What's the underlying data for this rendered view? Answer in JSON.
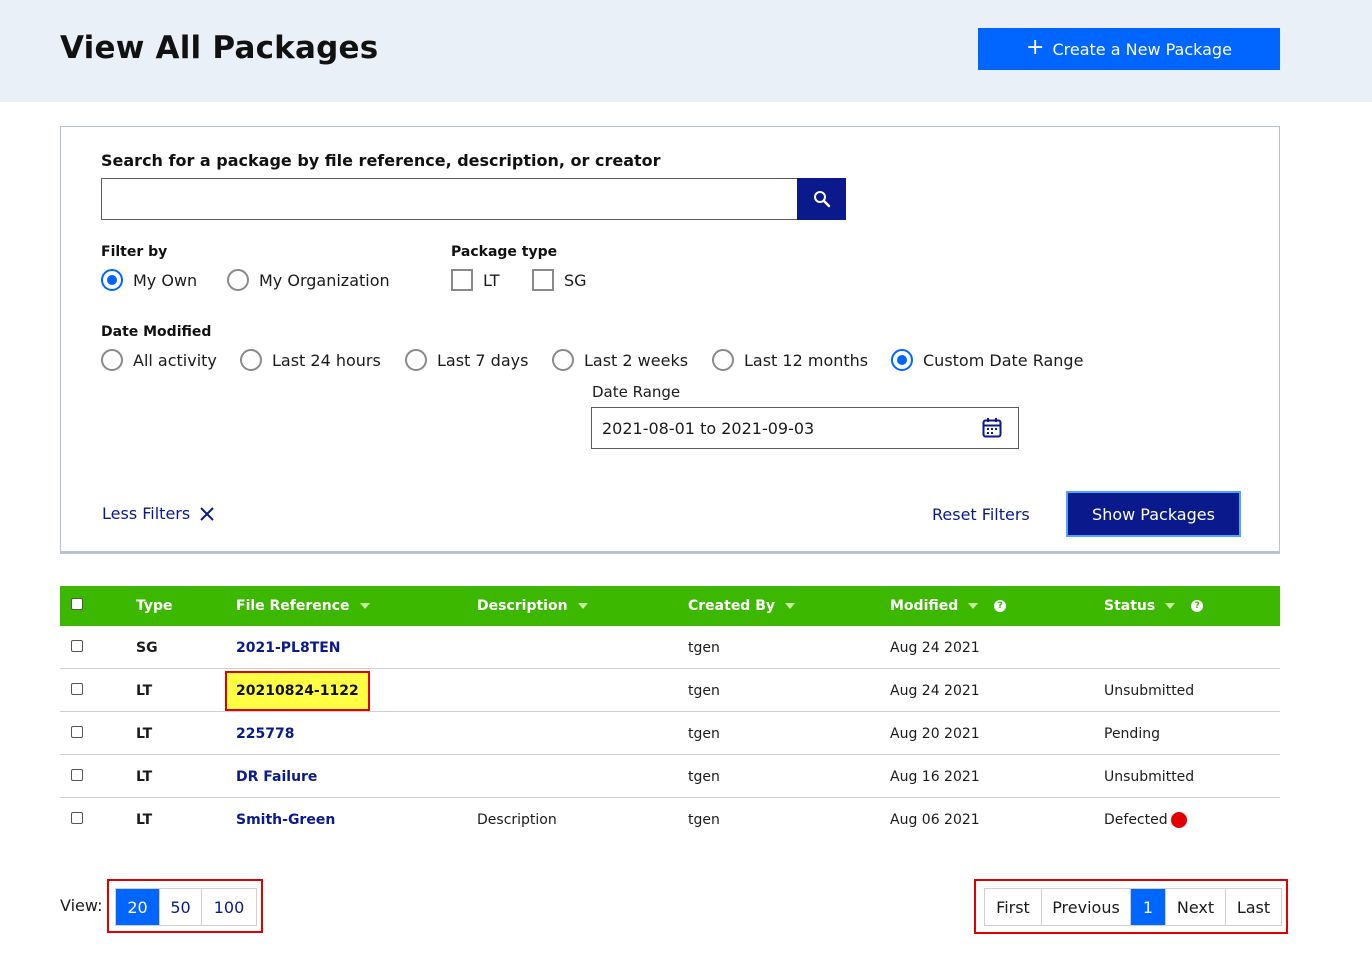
{
  "header": {
    "title": "View All Packages",
    "create_label": "Create a New Package"
  },
  "search": {
    "label": "Search for a package by file reference, description, or creator",
    "value": ""
  },
  "filter_by": {
    "label": "Filter by",
    "options": [
      "My Own",
      "My Organization"
    ],
    "selected": "My Own"
  },
  "package_type": {
    "label": "Package type",
    "options": [
      "LT",
      "SG"
    ]
  },
  "date_modified": {
    "label": "Date Modified",
    "options": [
      "All activity",
      "Last 24 hours",
      "Last 7 days",
      "Last 2 weeks",
      "Last 12 months",
      "Custom Date Range"
    ],
    "selected": "Custom Date Range"
  },
  "date_range": {
    "label": "Date Range",
    "value": "2021-08-01 to 2021-09-03"
  },
  "actions": {
    "less_filters": "Less Filters",
    "reset": "Reset Filters",
    "show": "Show Packages"
  },
  "table": {
    "columns": [
      "Type",
      "File Reference",
      "Description",
      "Created By",
      "Modified",
      "Status"
    ],
    "rows": [
      {
        "type": "SG",
        "ref": "2021-PL8TEN",
        "desc": "",
        "created_by": "tgen",
        "modified": "Aug 24 2021",
        "status": ""
      },
      {
        "type": "LT",
        "ref": "20210824-1122",
        "desc": "",
        "created_by": "tgen",
        "modified": "Aug 24 2021",
        "status": "Unsubmitted"
      },
      {
        "type": "LT",
        "ref": "225778",
        "desc": "",
        "created_by": "tgen",
        "modified": "Aug 20 2021",
        "status": "Pending"
      },
      {
        "type": "LT",
        "ref": "DR Failure",
        "desc": "",
        "created_by": "tgen",
        "modified": "Aug 16 2021",
        "status": "Unsubmitted"
      },
      {
        "type": "LT",
        "ref": "Smith-Green",
        "desc": "Description",
        "created_by": "tgen",
        "modified": "Aug 06 2021",
        "status": "Defected"
      }
    ]
  },
  "view": {
    "label": "View:",
    "options": [
      "20",
      "50",
      "100"
    ],
    "selected": "20"
  },
  "pager": {
    "first": "First",
    "previous": "Previous",
    "current": "1",
    "next": "Next",
    "last": "Last"
  },
  "colors": {
    "primary": "#0066ff",
    "navy": "#0a1a8c",
    "table_header": "#3cb800",
    "highlight": "#ffff44",
    "alert": "#e00000"
  }
}
